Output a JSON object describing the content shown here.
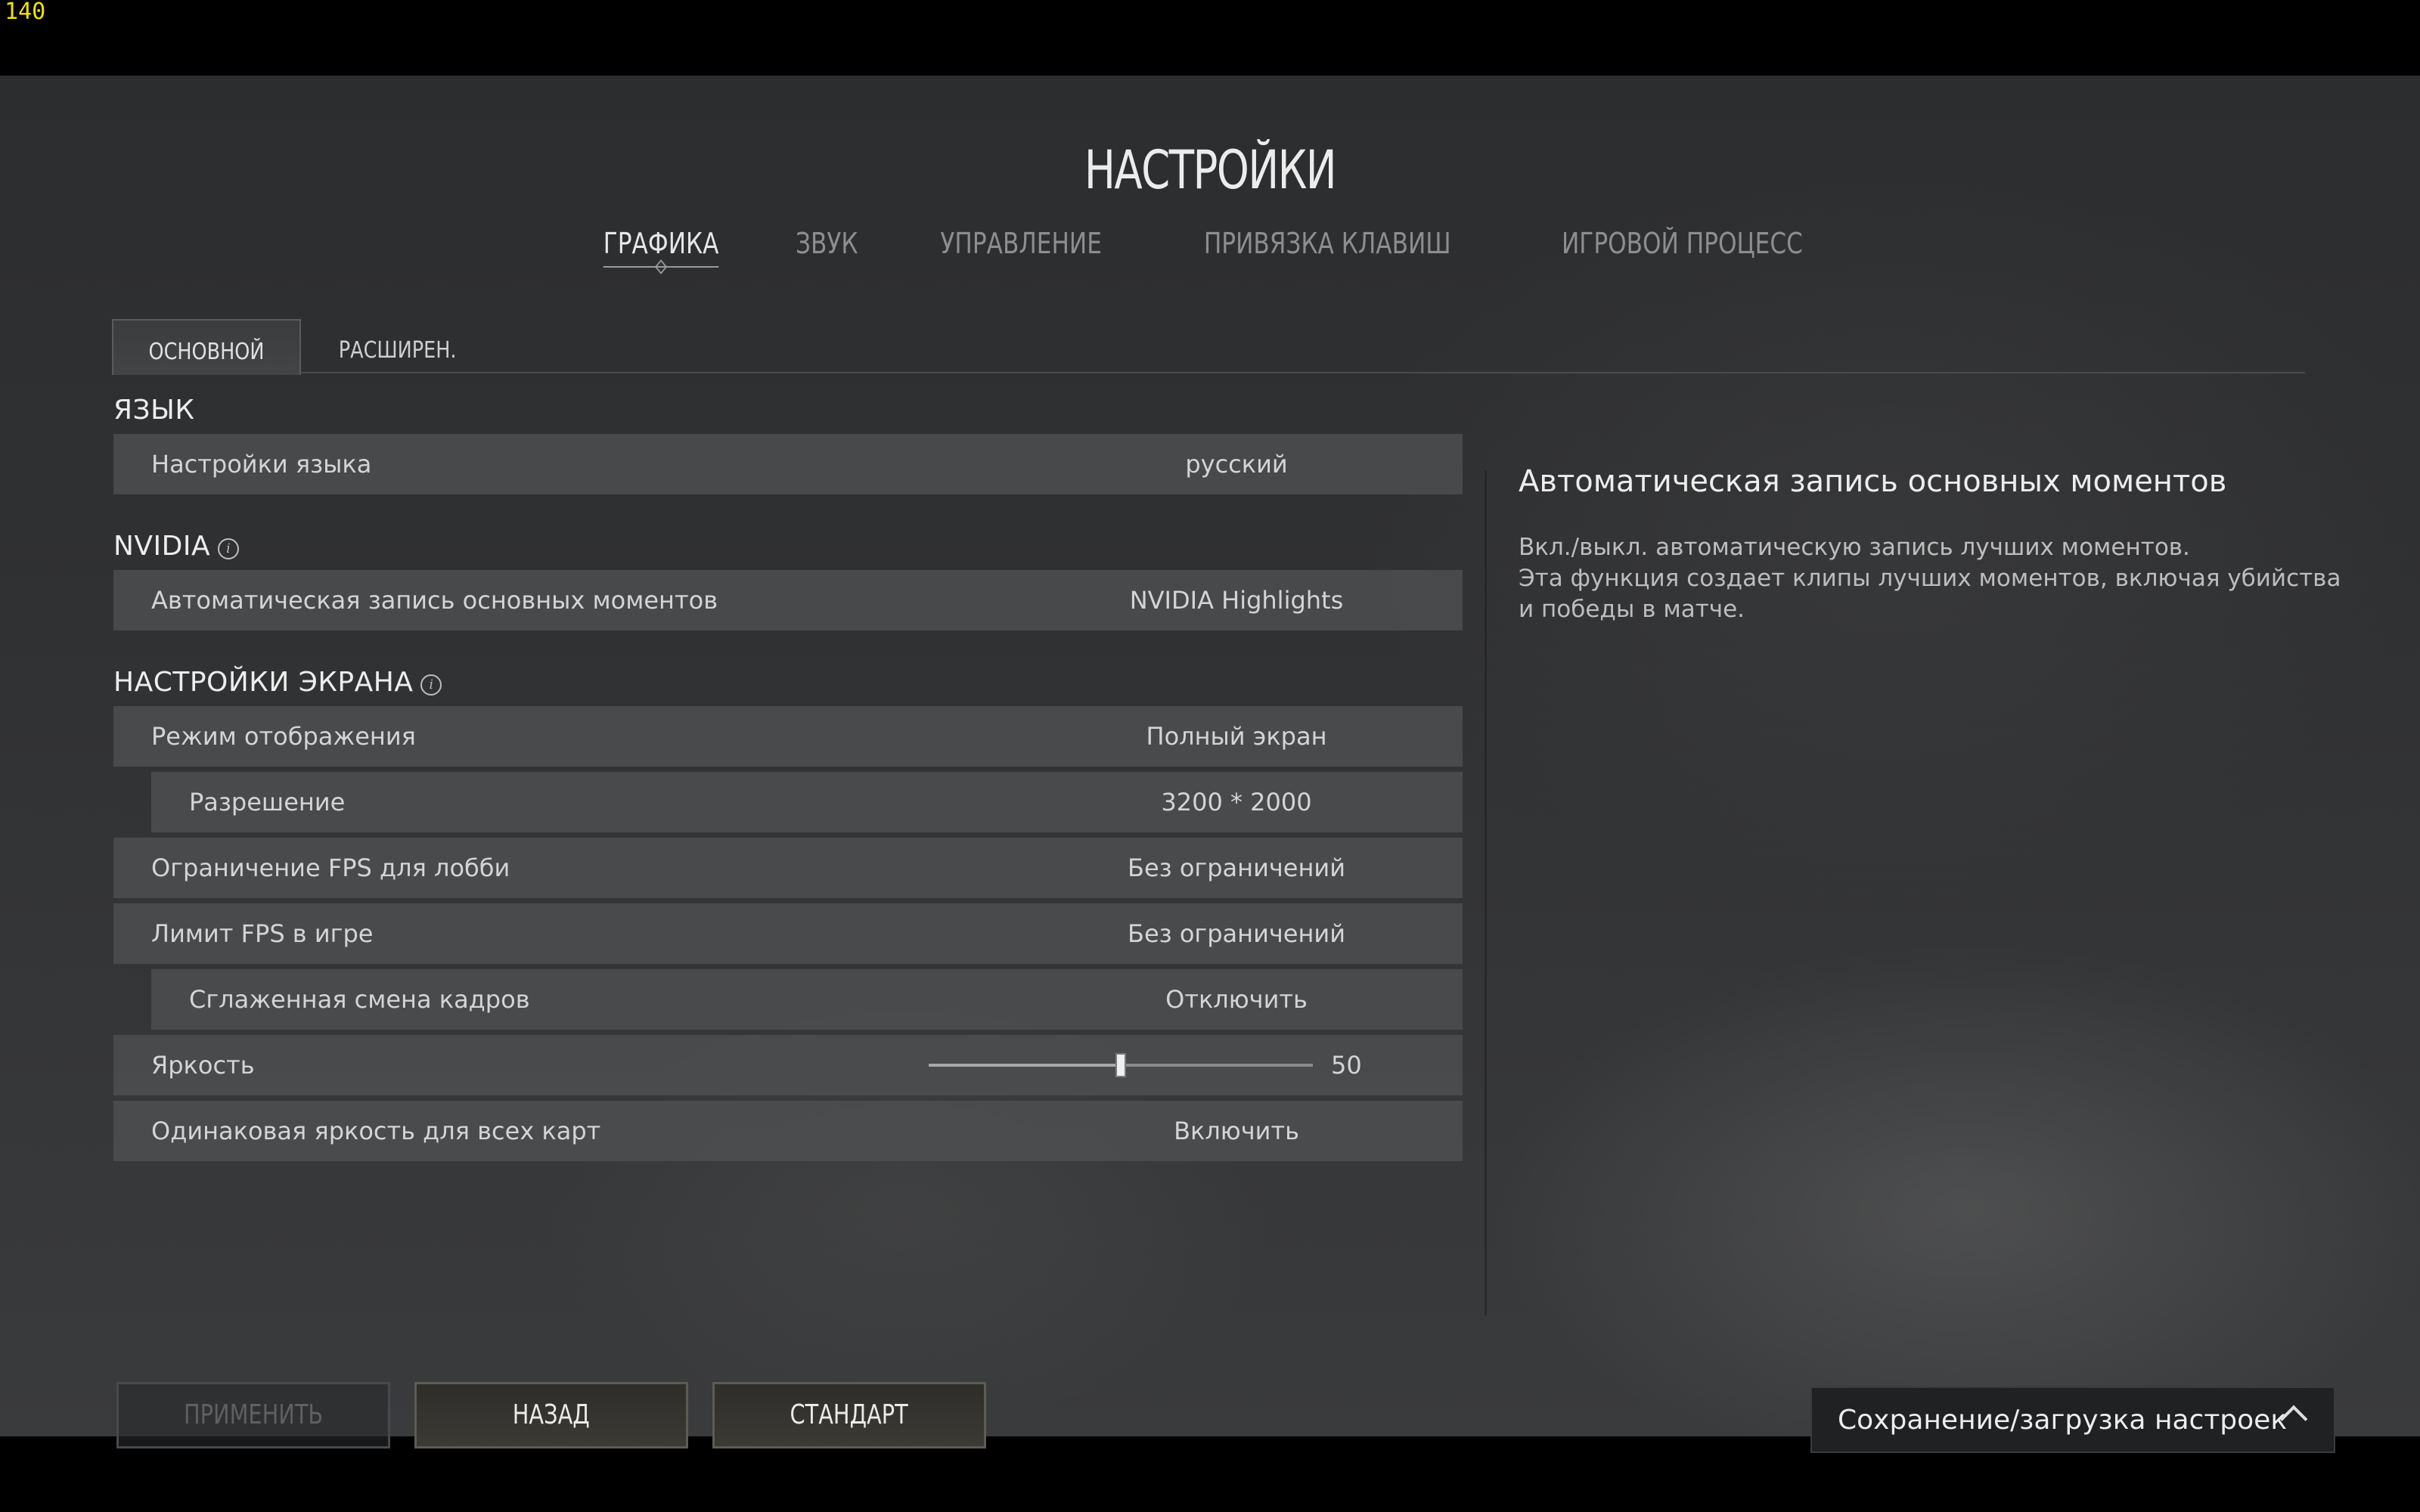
{
  "fps_counter": "140",
  "title": "НАСТРОЙКИ",
  "tabs": [
    {
      "label": "ГРАФИКА",
      "active": true
    },
    {
      "label": "ЗВУК",
      "active": false
    },
    {
      "label": "УПРАВЛЕНИЕ",
      "active": false
    },
    {
      "label": "ПРИВЯЗКА КЛАВИШ",
      "active": false
    },
    {
      "label": "ИГРОВОЙ ПРОЦЕСС",
      "active": false
    }
  ],
  "subtabs": [
    {
      "label": "ОСНОВНОЙ",
      "active": true
    },
    {
      "label": "РАСШИРЕН.",
      "active": false
    }
  ],
  "sections": {
    "language": {
      "header": "ЯЗЫК",
      "rows": [
        {
          "label": "Настройки языка",
          "value": "русский"
        }
      ]
    },
    "nvidia": {
      "header": "NVIDIA",
      "rows": [
        {
          "label": "Автоматическая запись основных моментов",
          "value": "NVIDIA Highlights"
        }
      ]
    },
    "screen": {
      "header": "НАСТРОЙКИ ЭКРАНА",
      "rows": [
        {
          "label": "Режим отображения",
          "value": "Полный экран"
        },
        {
          "label": "Разрешение",
          "value": "3200 * 2000"
        },
        {
          "label": "Ограничение FPS для лобби",
          "value": "Без ограничений"
        },
        {
          "label": "Лимит FPS в игре",
          "value": "Без ограничений"
        },
        {
          "label": "Сглаженная смена кадров",
          "value": "Отключить"
        },
        {
          "label": "Яркость",
          "value": "50",
          "slider_fraction": 0.5
        },
        {
          "label": "Одинаковая яркость для всех карт",
          "value": "Включить"
        }
      ]
    }
  },
  "description": {
    "title": "Автоматическая запись основных моментов",
    "lines": [
      "Вкл./выкл. автоматическую запись лучших моментов.",
      "Эта функция создает клипы лучших моментов, включая убийства",
      "и победы в матче."
    ]
  },
  "buttons": {
    "apply": "ПРИМЕНИТЬ",
    "back": "НАЗАД",
    "default": "СТАНДАРТ"
  },
  "save_load": {
    "label": "Сохранение/загрузка настроек"
  },
  "icons": {
    "info": "info-icon",
    "chevron": "chevron-up-icon"
  }
}
